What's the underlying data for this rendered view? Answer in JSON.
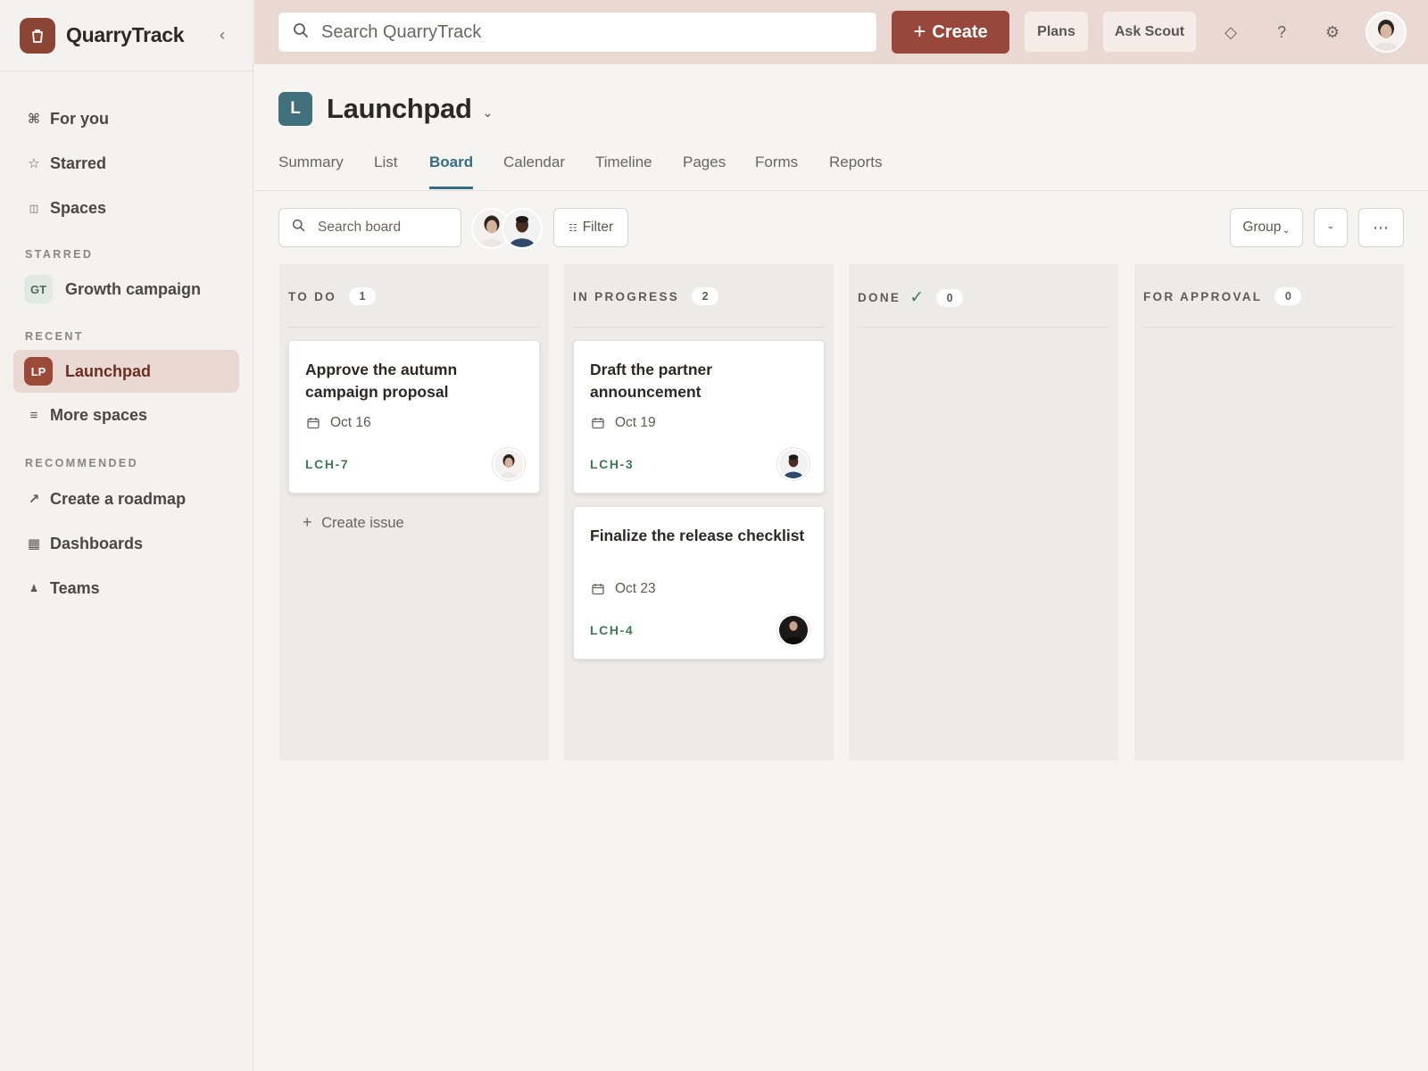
{
  "app": {
    "name": "QuarryTrack"
  },
  "sidebar": {
    "nav": [
      {
        "label": "For you",
        "icon": "command-icon"
      },
      {
        "label": "Starred",
        "icon": "star-icon"
      },
      {
        "label": "Spaces",
        "icon": "spaces-icon"
      }
    ],
    "starred_title": "STARRED",
    "starred": [
      {
        "label": "Growth campaign",
        "badge": "GT"
      }
    ],
    "recent_title": "RECENT",
    "recent": [
      {
        "label": "Launchpad",
        "badge": "LP",
        "active": true
      }
    ],
    "more_spaces": "More spaces",
    "recommended_title": "RECOMMENDED",
    "recommended": [
      {
        "label": "Create a roadmap",
        "icon": "arrow-up-right-icon"
      },
      {
        "label": "Dashboards",
        "icon": "grid-icon"
      },
      {
        "label": "Teams",
        "icon": "person-icon"
      }
    ]
  },
  "topbar": {
    "search_placeholder": "Search QuarryTrack",
    "create_label": "Create",
    "plans_label": "Plans",
    "ask_label": "Ask Scout"
  },
  "project": {
    "icon_letter": "L",
    "title": "Launchpad",
    "tabs": [
      "Summary",
      "List",
      "Board",
      "Calendar",
      "Timeline",
      "Pages",
      "Forms",
      "Reports"
    ],
    "active_tab": "Board"
  },
  "toolbar": {
    "search_placeholder": "Search board",
    "filter_label": "Filter",
    "group_label": "Group",
    "more_label": "⋯"
  },
  "board": {
    "columns": [
      {
        "title": "TO DO",
        "count": "1",
        "cards": [
          {
            "title": "Approve the autumn campaign proposal",
            "date": "Oct 16",
            "key": "LCH-7"
          }
        ],
        "create_label": "Create issue"
      },
      {
        "title": "IN PROGRESS",
        "count": "2",
        "cards": [
          {
            "title": "Draft the partner announcement",
            "date": "Oct 19",
            "key": "LCH-3"
          },
          {
            "title": "Finalize the release checklist",
            "date": "Oct 23",
            "key": "LCH-4"
          }
        ]
      },
      {
        "title": "DONE",
        "count": "0",
        "cards": []
      },
      {
        "title": "FOR APPROVAL",
        "count": "0",
        "cards": []
      }
    ]
  },
  "colors": {
    "brand": "#8b4535",
    "create": "#98483a",
    "topbar_bg": "#ead8d2",
    "active_tab": "#336d83",
    "issue_key": "#3f7a55",
    "project_icon": "#41707d"
  }
}
